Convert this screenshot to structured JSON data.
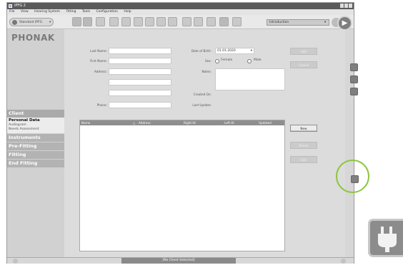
{
  "window": {
    "title": "iPFG 2"
  },
  "menu": [
    "File",
    "View",
    "Hearing System",
    "Fitting",
    "Tools",
    "Configuration",
    "Help"
  ],
  "toolbar": {
    "device_mode": "Standard iPFG",
    "dropdown_value": "Introduction",
    "icons": [
      "speaker-left-icon",
      "speaker-right-icon",
      "hearing-aid-icon",
      "audiogram-icon",
      "pencil-icon",
      "tool-icon",
      "settings-icon",
      "headset-icon",
      "graph-icon",
      "hearing-aid-small-icon",
      "data-icon",
      "chart-icon",
      "monitor-icon",
      "play-icon"
    ]
  },
  "brand": {
    "logo": "PHONAK"
  },
  "sidebar": {
    "sections": [
      {
        "title": "Client",
        "items": [
          "Personal Data",
          "Audiogram",
          "Needs Assessment"
        ]
      },
      {
        "title": "Instruments"
      },
      {
        "title": "Pre-Fitting"
      },
      {
        "title": "Fitting"
      },
      {
        "title": "End Fitting"
      }
    ]
  },
  "form": {
    "last_name_label": "Last Name:",
    "first_name_label": "First Name:",
    "address_label": "Address:",
    "phone_label": "Phone:",
    "dob_label": "Date of Birth:",
    "dob_value": "01.01.2020",
    "sex_label": "Sex:",
    "female_label": "Female",
    "male_label": "Male",
    "notes_label": "Notes:",
    "created_label": "Created On:",
    "updated_label": "Last Update:",
    "add_label": "Add",
    "cancel_label": "Cancel"
  },
  "table": {
    "columns": [
      "Name",
      "Address",
      "Right HI",
      "Left HI",
      "Updated"
    ],
    "new_label": "New",
    "delete_label": "Delete",
    "edit_label": "Edit"
  },
  "status": {
    "text": "[No Client Selected]"
  },
  "highlight": {
    "color": "#8dc63f"
  },
  "zoom_icon": "plug-icon"
}
